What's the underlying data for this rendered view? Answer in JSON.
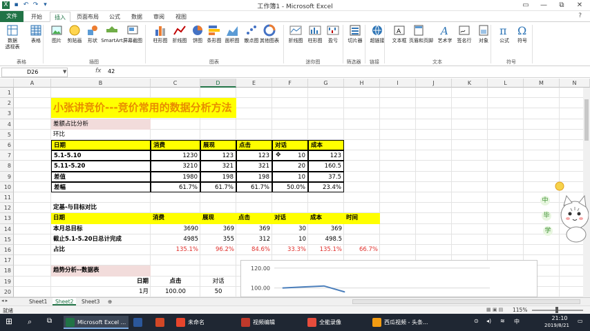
{
  "window": {
    "title": "工作簿1 - Microsoft Excel",
    "qat_icons": [
      "excel-logo-icon",
      "save-icon",
      "undo-icon",
      "redo-icon",
      "customize-icon"
    ],
    "controls": [
      "?",
      "▭",
      "—",
      "⧉",
      "✕"
    ]
  },
  "tabs": [
    "文件",
    "开始",
    "插入",
    "页面布局",
    "公式",
    "数据",
    "审阅",
    "视图"
  ],
  "active_tab": "插入",
  "ribbon": {
    "buttons": [
      {
        "label": "数据\n透视表",
        "icon": "pivot-table-icon"
      },
      {
        "label": "表格",
        "icon": "table-icon"
      },
      {
        "label": "图片",
        "icon": "picture-icon"
      },
      {
        "label": "剪贴画",
        "icon": "clipart-icon"
      },
      {
        "label": "形状",
        "icon": "shapes-icon"
      },
      {
        "label": "SmartArt",
        "icon": "smartart-icon"
      },
      {
        "label": "屏幕截图",
        "icon": "screenshot-icon"
      },
      {
        "label": "柱形图",
        "icon": "column-chart-icon"
      },
      {
        "label": "折线图",
        "icon": "line-chart-icon"
      },
      {
        "label": "饼图",
        "icon": "pie-chart-icon"
      },
      {
        "label": "条形图",
        "icon": "bar-chart-icon"
      },
      {
        "label": "面积图",
        "icon": "area-chart-icon"
      },
      {
        "label": "散点图",
        "icon": "scatter-chart-icon"
      },
      {
        "label": "其他图表",
        "icon": "other-charts-icon"
      },
      {
        "label": "折线图",
        "icon": "sparkline-line-icon"
      },
      {
        "label": "柱形图",
        "icon": "sparkline-column-icon"
      },
      {
        "label": "盈亏",
        "icon": "sparkline-winloss-icon"
      },
      {
        "label": "切片器",
        "icon": "slicer-icon"
      },
      {
        "label": "超链接",
        "icon": "hyperlink-icon"
      },
      {
        "label": "文本框",
        "icon": "textbox-icon"
      },
      {
        "label": "页眉和页脚",
        "icon": "header-footer-icon"
      },
      {
        "label": "艺术字",
        "icon": "wordart-icon"
      },
      {
        "label": "签名行",
        "icon": "signature-icon"
      },
      {
        "label": "对象",
        "icon": "object-icon"
      },
      {
        "label": "公式",
        "icon": "equation-icon"
      },
      {
        "label": "符号",
        "icon": "symbol-icon"
      }
    ],
    "groups": [
      "表格",
      "插图",
      "图表",
      "迷你图",
      "筛选器",
      "链接",
      "文本",
      "符号"
    ]
  },
  "formula_bar": {
    "name_box": "D26",
    "fx": "fx",
    "value": "42"
  },
  "columns": [
    "A",
    "B",
    "C",
    "D",
    "E",
    "F",
    "G",
    "H",
    "I",
    "J",
    "K",
    "L",
    "M",
    "N"
  ],
  "selected_column": "D",
  "rows": [
    "1",
    "2",
    "3",
    "4",
    "5",
    "6",
    "7",
    "8",
    "9",
    "10",
    "11",
    "12",
    "13",
    "14",
    "15",
    "16",
    "17",
    "18",
    "19",
    "20"
  ],
  "sheet": {
    "title": "小张讲竞价---竞价常用的数据分析方法",
    "section1_label": "差额占比分析",
    "section1_sub": "环比",
    "table1": {
      "headers": [
        "日期",
        "消费",
        "展现",
        "点击",
        "对话",
        "成本"
      ],
      "rows": [
        [
          "5.1-5.10",
          "1230",
          "123",
          "123",
          "10",
          "123"
        ],
        [
          "5.11-5.20",
          "3210",
          "321",
          "321",
          "20",
          "160.5"
        ],
        [
          "差值",
          "1980",
          "198",
          "198",
          "10",
          "37.5"
        ],
        [
          "差幅",
          "61.7%",
          "61.7%",
          "61.7%",
          "50.0%",
          "23.4%"
        ]
      ]
    },
    "section2_label": "定基-与目标对比",
    "table2": {
      "headers": [
        "日期",
        "消费",
        "展现",
        "点击",
        "对话",
        "成本",
        "时间"
      ],
      "rows": [
        [
          "本月总目标",
          "3690",
          "369",
          "369",
          "30",
          "369",
          ""
        ],
        [
          "截止5.1-5.20日总计完成",
          "4985",
          "355",
          "312",
          "10",
          "498.5",
          ""
        ],
        [
          "占比",
          "135.1%",
          "96.2%",
          "84.6%",
          "33.3%",
          "135.1%",
          "66.7%"
        ]
      ]
    },
    "section3_label": "趋势分析--数据表",
    "table3": {
      "headers": [
        "日期",
        "点击",
        "对话"
      ],
      "rows": [
        [
          "1月",
          "100.00",
          "50"
        ]
      ]
    }
  },
  "chart_data": {
    "type": "line",
    "yticks": [
      "120.00",
      "100.00"
    ],
    "ylim": [
      90,
      120
    ],
    "series": [
      {
        "values": [
          100,
          101,
          102,
          96
        ]
      }
    ]
  },
  "sheet_tabs": [
    "Sheet1",
    "Sheet2",
    "Sheet3"
  ],
  "active_sheet": "Sheet2",
  "status": {
    "ready": "就绪",
    "zoom": "115%"
  },
  "mascot": {
    "chars": [
      "中",
      "毕",
      "学"
    ]
  },
  "taskbar": {
    "items": [
      {
        "label": "Microsoft Excel ...",
        "color": "#217346"
      },
      {
        "label": "",
        "color": "#2b579a"
      },
      {
        "label": "",
        "color": "#d24726"
      },
      {
        "label": "未命名",
        "color": "#e8452c"
      },
      {
        "label": "视频编辑",
        "color": "#c0392b"
      },
      {
        "label": "全能录像",
        "color": "#e74c3c"
      },
      {
        "label": "西瓜视频 - 头条...",
        "color": "#f39c12"
      }
    ],
    "ime": "中",
    "time": "21:10",
    "date": "2019/8/21"
  }
}
